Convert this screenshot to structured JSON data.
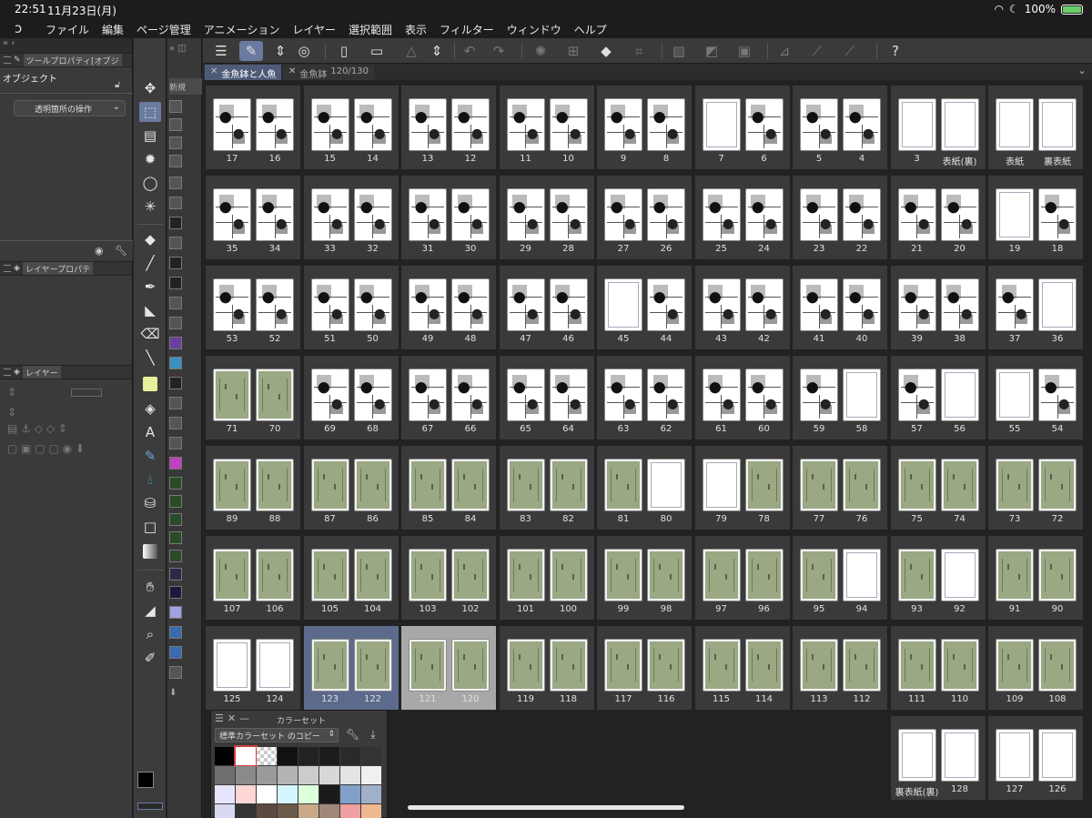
{
  "status": {
    "time": "22:51",
    "date": "11月23日(月)",
    "battery": "100%"
  },
  "menu": [
    "ファイル",
    "編集",
    "ページ管理",
    "アニメーション",
    "レイヤー",
    "選択範囲",
    "表示",
    "フィルター",
    "ウィンドウ",
    "ヘルプ"
  ],
  "left_panel": {
    "tool_property_title": "ツールプロパティ[オブジ",
    "object_label": "オブジェクト",
    "transparent_op_label": "透明箇所の操作",
    "layer_property_title": "レイヤープロパテ",
    "layer_title": "レイヤー"
  },
  "subtool": {
    "top_label": "新規"
  },
  "tabs": [
    {
      "label": "金魚鉢と人魚",
      "active": true
    },
    {
      "label": "金魚鉢",
      "pages": "120/130",
      "active": false
    }
  ],
  "pages": [
    [
      "17",
      "16",
      "15",
      "14",
      "13",
      "12",
      "11",
      "10",
      "9",
      "8",
      "7",
      "6",
      "5",
      "4",
      "3",
      "表紙(裏)",
      "表紙",
      "裏表紙"
    ],
    [
      "35",
      "34",
      "33",
      "32",
      "31",
      "30",
      "29",
      "28",
      "27",
      "26",
      "25",
      "24",
      "23",
      "22",
      "21",
      "20",
      "19",
      "18"
    ],
    [
      "53",
      "52",
      "51",
      "50",
      "49",
      "48",
      "47",
      "46",
      "45",
      "44",
      "43",
      "42",
      "41",
      "40",
      "39",
      "38",
      "37",
      "36"
    ],
    [
      "71",
      "70",
      "69",
      "68",
      "67",
      "66",
      "65",
      "64",
      "63",
      "62",
      "61",
      "60",
      "59",
      "58",
      "57",
      "56",
      "55",
      "54"
    ],
    [
      "89",
      "88",
      "87",
      "86",
      "85",
      "84",
      "83",
      "82",
      "81",
      "80",
      "79",
      "78",
      "77",
      "76",
      "75",
      "74",
      "73",
      "72"
    ],
    [
      "107",
      "106",
      "105",
      "104",
      "103",
      "102",
      "101",
      "100",
      "99",
      "98",
      "97",
      "96",
      "95",
      "94",
      "93",
      "92",
      "91",
      "90"
    ],
    [
      "125",
      "124",
      "123",
      "122",
      "121",
      "120",
      "119",
      "118",
      "117",
      "116",
      "115",
      "114",
      "113",
      "112",
      "111",
      "110",
      "109",
      "108"
    ],
    [
      "裏表紙(裏)",
      "128",
      "127",
      "126"
    ]
  ],
  "page_kinds": [
    [
      "M",
      "M",
      "M",
      "M",
      "M",
      "M",
      "M",
      "M",
      "M",
      "M",
      "B",
      "M",
      "M",
      "M",
      "B",
      "B",
      "B",
      "B"
    ],
    [
      "M",
      "M",
      "M",
      "M",
      "M",
      "M",
      "M",
      "M",
      "M",
      "M",
      "M",
      "M",
      "M",
      "M",
      "M",
      "M",
      "B",
      "M"
    ],
    [
      "M",
      "M",
      "M",
      "M",
      "M",
      "M",
      "M",
      "M",
      "B",
      "M",
      "M",
      "M",
      "M",
      "M",
      "M",
      "M",
      "M",
      "B"
    ],
    [
      "S",
      "S",
      "M",
      "M",
      "M",
      "M",
      "M",
      "M",
      "M",
      "M",
      "M",
      "M",
      "M",
      "B",
      "M",
      "B",
      "B",
      "M"
    ],
    [
      "S",
      "S",
      "S",
      "S",
      "S",
      "S",
      "S",
      "S",
      "S",
      "B",
      "B",
      "S",
      "S",
      "S",
      "S",
      "S",
      "S",
      "S"
    ],
    [
      "S",
      "S",
      "S",
      "S",
      "S",
      "S",
      "S",
      "S",
      "S",
      "S",
      "S",
      "S",
      "S",
      "B",
      "S",
      "B",
      "S",
      "S"
    ],
    [
      "B",
      "B",
      "S",
      "S",
      "S",
      "S",
      "S",
      "S",
      "S",
      "S",
      "S",
      "S",
      "S",
      "S",
      "S",
      "S",
      "S",
      "S"
    ],
    [
      "B",
      "B",
      "B",
      "B"
    ]
  ],
  "selected_page": "123",
  "current_page": "120",
  "color_set": {
    "panel_title": "カラーセット",
    "set_name": "標準カラーセット のコピー",
    "swatches": [
      "#000000",
      "#ffffff",
      "checker",
      "#111111",
      "#222222",
      "#1c1c1c",
      "#2a2a2a",
      "#333333",
      "#6e6e6e",
      "#8a8a8a",
      "#9a9a9a",
      "#b4b4b4",
      "#cccccc",
      "#d8d8d8",
      "#e4e4e4",
      "#f0f0f0",
      "#e6e6ff",
      "#ffd6d6",
      "#ffffff",
      "#d6f6ff",
      "#dcffdc",
      "#1a1a1a",
      "#80a0c8",
      "#a0b0c8",
      "#d8d8f0",
      "#333333",
      "#5a4a40",
      "#6a5a4a",
      "#c8a888",
      "#a08878",
      "#f0a0a0",
      "#f0b890"
    ]
  }
}
